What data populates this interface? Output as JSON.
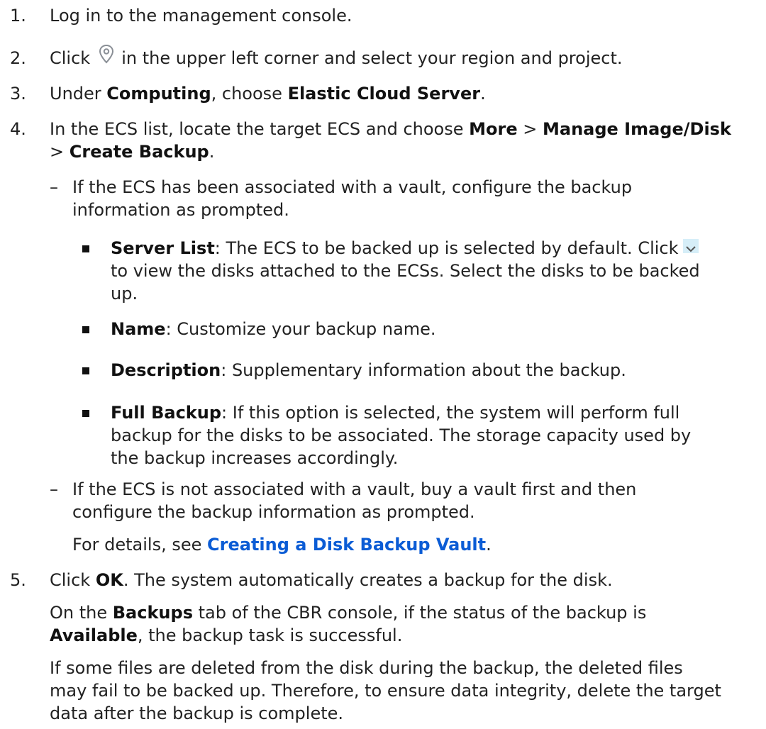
{
  "steps": {
    "s1": {
      "num": "1.",
      "text": "Log in to the management console."
    },
    "s2": {
      "num": "2.",
      "before": "Click",
      "icon": "location-pin-icon",
      "after": "in the upper left corner and select your region and project."
    },
    "s3": {
      "num": "3.",
      "a": "Under ",
      "b1": "Computing",
      "c": ", choose ",
      "b2": "Elastic Cloud Server",
      "d": "."
    },
    "s4": {
      "num": "4.",
      "a": "In the ECS list, locate the target ECS and choose ",
      "b1": "More",
      "c": " > ",
      "b2": "Manage Image/Disk",
      "l2a": "> ",
      "b3": "Create Backup",
      "l2b": "."
    },
    "s5": {
      "num": "5.",
      "b1": "OK",
      "text": "Click ",
      "rest": ". The system automatically creates a backup for the disk."
    }
  },
  "subs": {
    "dash": "–",
    "assoc": {
      "l1": "If the ECS has been associated with a vault, configure the backup",
      "l2": "information as prompted."
    },
    "notassoc": {
      "l1": "If the ECS is not associated with a vault, buy a vault first and then",
      "l2": "configure the backup information as prompted.",
      "details_prefix": "For details, see ",
      "link": "Creating a Disk Backup Vault",
      "details_suffix": "."
    }
  },
  "bullets": {
    "server_list": {
      "label": "Server List",
      "l1": ": The ECS to be backed up is selected by default. Click",
      "chevron_icon": "chevron-down-icon",
      "l2": "to view the disks attached to the ECSs. Select the disks to be backed",
      "l3": "up."
    },
    "name": {
      "label": "Name",
      "text": ": Customize your backup name."
    },
    "description": {
      "label": "Description",
      "text": ": Supplementary information about the backup."
    },
    "full_backup": {
      "label": "Full Backup",
      "l1": ": If this option is selected, the system will perform full",
      "l2": "backup for the disks to be associated. The storage capacity used by",
      "l3": "the backup increases accordingly."
    }
  },
  "after5": {
    "p1a": "On the ",
    "p1b": "Backups",
    "p1c": " tab of the CBR console, if the status of the backup is",
    "p2b": "Available",
    "p2c": ", the backup task is successful.",
    "p3l1": "If some files are deleted from the disk during the backup, the deleted files",
    "p3l2": "may fail to be backed up. Therefore, to ensure data integrity, delete the target",
    "p3l3": "data after the backup is complete."
  },
  "colors": {
    "link": "#0b5cd5",
    "chevron_bg": "#d6eef8",
    "pin": "#8a8f96"
  }
}
